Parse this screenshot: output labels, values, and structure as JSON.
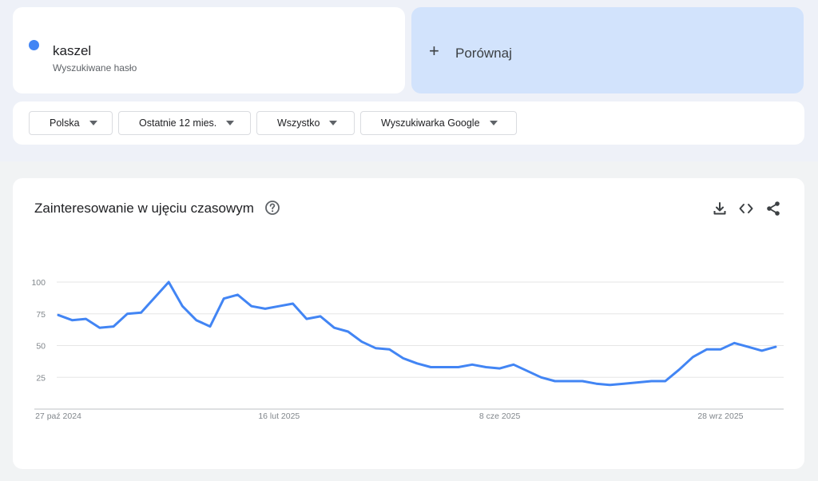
{
  "term": {
    "name": "kaszel",
    "subtitle": "Wyszukiwane hasło",
    "color": "#4285f4"
  },
  "compare": {
    "label": "Porównaj",
    "plus": "+",
    "background": "#d2e3fc"
  },
  "filters": [
    {
      "label": "Polska"
    },
    {
      "label": "Ostatnie 12 mies."
    },
    {
      "label": "Wszystko"
    },
    {
      "label": "Wyszukiwarka Google"
    }
  ],
  "chart_header": {
    "title": "Zainteresowanie w ujęciu czasowym"
  },
  "icons": {
    "help": "help-circle-icon",
    "download": "download-icon",
    "embed": "embed-code-icon",
    "share": "share-icon"
  },
  "chart_data": {
    "type": "line",
    "title": "Zainteresowanie w ujęciu czasowym",
    "xlabel": "",
    "ylabel": "",
    "ylim": [
      0,
      100
    ],
    "yticks": [
      25,
      50,
      75,
      100
    ],
    "grid": true,
    "x_tick_labels": [
      {
        "label": "27 paź 2024",
        "index": 0
      },
      {
        "label": "16 lut 2025",
        "index": 16
      },
      {
        "label": "8 cze 2025",
        "index": 32
      },
      {
        "label": "28 wrz 2025",
        "index": 48
      }
    ],
    "series": [
      {
        "color": "#4285f4",
        "values": [
          74,
          70,
          71,
          64,
          65,
          75,
          76,
          88,
          100,
          81,
          70,
          65,
          87,
          90,
          81,
          79,
          81,
          83,
          71,
          73,
          64,
          61,
          53,
          48,
          47,
          40,
          36,
          33,
          33,
          33,
          35,
          33,
          32,
          35,
          30,
          25,
          22,
          22,
          22,
          20,
          19,
          20,
          21,
          22,
          22,
          31,
          41,
          47,
          47,
          52,
          49,
          46,
          49
        ]
      }
    ]
  }
}
